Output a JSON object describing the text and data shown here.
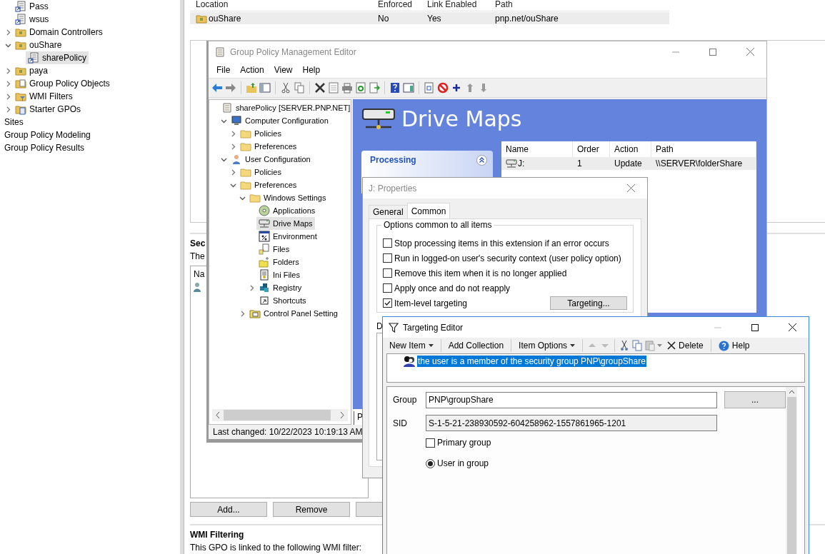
{
  "gpmc_tree": {
    "domain_items": [
      {
        "label": "Pass",
        "kind": "gpo-link",
        "selected": false
      },
      {
        "label": "wsus",
        "kind": "gpo-link",
        "selected": false
      },
      {
        "label": "Domain Controllers",
        "kind": "ou",
        "expanded": false,
        "selected": false
      },
      {
        "label": "ouShare",
        "kind": "ou",
        "expanded": true,
        "selected": false,
        "children": [
          {
            "label": "sharePolicy",
            "kind": "gpo-link",
            "selected": true
          }
        ]
      },
      {
        "label": "paya",
        "kind": "ou",
        "expanded": false,
        "selected": false
      },
      {
        "label": "Group Policy Objects",
        "kind": "gpo-folder",
        "expanded": false,
        "selected": false
      },
      {
        "label": "WMI Filters",
        "kind": "wmi-folder",
        "expanded": false,
        "selected": false
      },
      {
        "label": "Starter GPOs",
        "kind": "starter-folder",
        "expanded": false,
        "selected": false
      }
    ],
    "root_items": [
      {
        "label": "Sites",
        "selected": false
      },
      {
        "label": "Group Policy Modeling",
        "selected": false
      },
      {
        "label": "Group Policy Results",
        "selected": false
      }
    ]
  },
  "links_table": {
    "columns": [
      "Location",
      "Enforced",
      "Link Enabled",
      "Path"
    ],
    "rows": [
      {
        "cells": [
          "ouShare",
          "No",
          "Yes",
          "pnp.net/ouShare"
        ],
        "selected": true
      }
    ]
  },
  "security_filtering": {
    "heading": "Sec",
    "description": "The",
    "list_header": "Na",
    "buttons": [
      "Add...",
      "Remove"
    ]
  },
  "wmi_filtering": {
    "heading": "WMI Filtering",
    "description": "This GPO is linked to the following WMI filter:"
  },
  "editor": {
    "title": "Group Policy Management Editor",
    "menu": [
      "File",
      "Action",
      "View",
      "Help"
    ],
    "tree": [
      {
        "label": "sharePolicy [SERVER.PNP.NET]",
        "kind": "policy",
        "selected": false,
        "children": [
          {
            "label": "Computer Configuration",
            "kind": "computer",
            "expanded": true,
            "selected": false,
            "children": [
              {
                "label": "Policies",
                "kind": "folder",
                "expanded": false,
                "selected": false
              },
              {
                "label": "Preferences",
                "kind": "folder",
                "expanded": false,
                "selected": false
              }
            ]
          },
          {
            "label": "User Configuration",
            "kind": "user",
            "expanded": true,
            "selected": false,
            "children": [
              {
                "label": "Policies",
                "kind": "folder",
                "expanded": false,
                "selected": false
              },
              {
                "label": "Preferences",
                "kind": "folder",
                "expanded": true,
                "selected": false,
                "children": [
                  {
                    "label": "Windows Settings",
                    "kind": "folder",
                    "expanded": true,
                    "selected": false,
                    "children": [
                      {
                        "label": "Applications",
                        "kind": "disc",
                        "selected": false
                      },
                      {
                        "label": "Drive Maps",
                        "kind": "drive",
                        "selected": true
                      },
                      {
                        "label": "Environment",
                        "kind": "environment",
                        "selected": false
                      },
                      {
                        "label": "Files",
                        "kind": "files",
                        "selected": false
                      },
                      {
                        "label": "Folders",
                        "kind": "folders",
                        "selected": false
                      },
                      {
                        "label": "Ini Files",
                        "kind": "ini",
                        "selected": false
                      },
                      {
                        "label": "Registry",
                        "kind": "registry",
                        "expanded": false,
                        "selected": false
                      },
                      {
                        "label": "Shortcuts",
                        "kind": "shortcut",
                        "selected": false
                      }
                    ]
                  },
                  {
                    "label": "Control Panel Setting",
                    "kind": "control-panel",
                    "expanded": false,
                    "selected": false
                  }
                ]
              }
            ]
          }
        ]
      }
    ],
    "status": "Last changed: 10/22/2023 10:19:13 AM",
    "extension": {
      "title": "Drive Maps",
      "processing": "Processing",
      "columns": [
        "Name",
        "Order",
        "Action",
        "Path"
      ],
      "rows": [
        {
          "cells": [
            "J:",
            "1",
            "Update",
            "\\\\SERVER\\folderShare"
          ],
          "selected": true
        }
      ],
      "tab": "P"
    }
  },
  "properties": {
    "title": "J: Properties",
    "tabs": [
      {
        "label": "General",
        "selected": false
      },
      {
        "label": "Common",
        "selected": true
      }
    ],
    "group_title": "Options common to all items",
    "options": [
      {
        "label": "Stop processing items in this extension if an error occurs",
        "checked": false
      },
      {
        "label": "Run in logged-on user's security context (user policy option)",
        "checked": false
      },
      {
        "label": "Remove this item when it is no longer applied",
        "checked": false
      },
      {
        "label": "Apply once and do not reapply",
        "checked": false
      },
      {
        "label": "Item-level targeting",
        "checked": true
      }
    ],
    "targeting_button": "Targeting...",
    "description_label": "D"
  },
  "targeting": {
    "title": "Targeting Editor",
    "toolbar": [
      {
        "label": "New Item",
        "dropdown": true
      },
      {
        "label": "Add Collection",
        "dropdown": false
      },
      {
        "label": "Item Options",
        "dropdown": true
      }
    ],
    "delete": "Delete",
    "help": "Help",
    "items": [
      {
        "label": "the user is a member of the security group PNP\\groupShare",
        "selected": true
      }
    ],
    "group_label": "Group",
    "group_value": "PNP\\groupShare",
    "browse": "...",
    "sid_label": "SID",
    "sid_value": "S-1-5-21-238930592-604258962-1557861965-1201",
    "primary": {
      "label": "Primary group",
      "checked": false
    },
    "user_in_group": {
      "label": "User in group",
      "selected": true
    }
  }
}
